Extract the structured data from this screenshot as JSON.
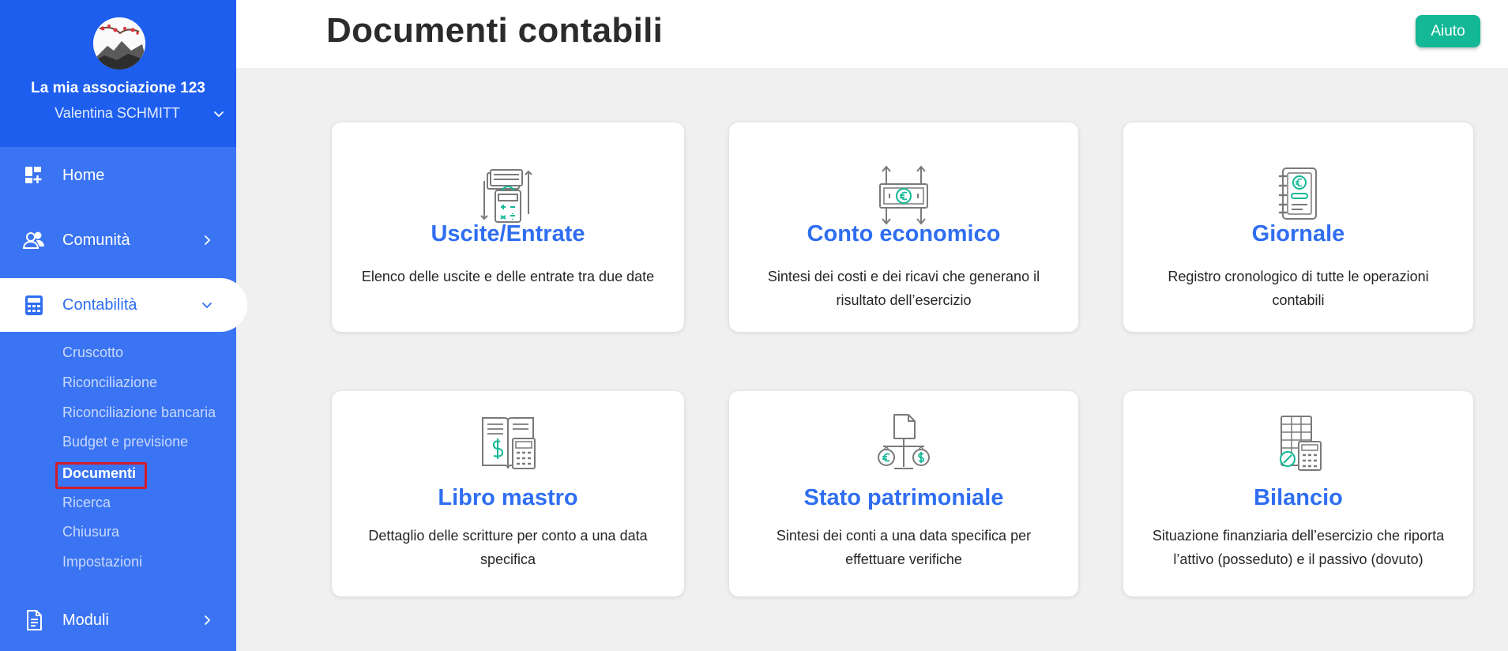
{
  "sidebar": {
    "org_name": "La mia associazione 123",
    "user_name": "Valentina SCHMITT",
    "nav": {
      "home": "Home",
      "community": "Comunità",
      "accounting": "Contabilità",
      "modules": "Moduli"
    },
    "submenu": [
      "Cruscotto",
      "Riconciliazione",
      "Riconciliazione bancaria",
      "Budget e previsione",
      "Documenti",
      "Ricerca",
      "Chiusura",
      "Impostazioni"
    ],
    "current_submenu": "Documenti"
  },
  "header": {
    "title": "Documenti contabili",
    "help_label": "Aiuto"
  },
  "cards": [
    {
      "title": "Uscite/Entrate",
      "description": "Elenco delle uscite e delle entrate tra due date",
      "icon": "calculator-documents-icon"
    },
    {
      "title": "Conto economico",
      "description": "Sintesi dei costi e dei ricavi che generano il risultato dell’esercizio",
      "icon": "euro-banknote-icon"
    },
    {
      "title": "Giornale",
      "description": "Registro cronologico di tutte le operazioni contabili",
      "icon": "journal-notebook-icon"
    },
    {
      "title": "Libro mastro",
      "description": "Dettaglio delle scritture per conto a una data specifica",
      "icon": "ledger-book-icon"
    },
    {
      "title": "Stato patrimoniale",
      "description": "Sintesi dei conti a una data specifica per effettuare verifiche",
      "icon": "balance-scale-icon"
    },
    {
      "title": "Bilancio",
      "description": "Situazione finanziaria dell’esercizio che riporta l’attivo (posseduto) e il passivo (dovuto)",
      "icon": "spreadsheet-calculator-icon"
    }
  ],
  "colors": {
    "sidebar": "#3a74f2",
    "sidebar_header": "#1d5eee",
    "accent": "#2f6ef0",
    "help_button": "#14b896",
    "highlight": "#d11c2c",
    "icon_teal": "#14b896",
    "icon_gray": "#7a7a7a"
  }
}
